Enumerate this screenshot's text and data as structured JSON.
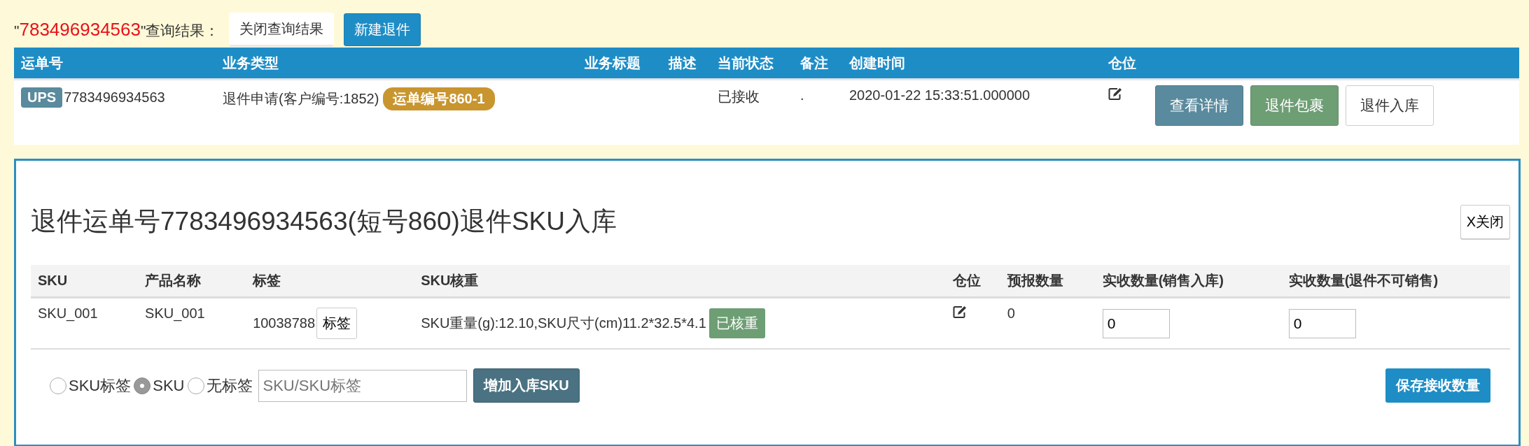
{
  "query": {
    "open_quote": "\"",
    "number": "783496934563",
    "suffix": "\"查询结果：",
    "buttons": [
      {
        "label": "关闭查询结果",
        "kind": "plain"
      },
      {
        "label": "新建退件",
        "kind": "primary"
      }
    ]
  },
  "results": {
    "columns": [
      "运单号",
      "业务类型",
      "业务标题",
      "描述",
      "当前状态",
      "备注",
      "创建时间",
      "仓位"
    ],
    "rows": [
      {
        "carrier": "UPS",
        "tracking": "7783496934563",
        "type": "退件申请(客户编号:1852)",
        "tag": "运单编号860-1",
        "status": "已接收",
        "note": ".",
        "created": "2020-01-22 15:33:51.000000",
        "actions": [
          {
            "label": "查看详情",
            "kind": "info"
          },
          {
            "label": "退件包裹",
            "kind": "success"
          },
          {
            "label": "退件入库",
            "kind": "plain"
          }
        ]
      }
    ]
  },
  "panel": {
    "title": "退件运单号7783496934563(短号860)退件SKU入库",
    "close_button": "X关闭",
    "columns": [
      "SKU",
      "产品名称",
      "标签",
      "SKU核重",
      "仓位",
      "预报数量",
      "实收数量(销售入库)",
      "实收数量(退件不可销售)"
    ],
    "rows": [
      {
        "sku": "SKU_001",
        "name": "SKU_001",
        "label_code": "10038788",
        "label_button": "标签",
        "check": "SKU重量(g):12.10,SKU尺寸(cm)11.2*32.5*4.1",
        "check_badge": "已核重",
        "forecast": "0",
        "qty_sale": "0",
        "qty_return": "0"
      }
    ],
    "mode_options": [
      {
        "label": "SKU标签",
        "selected": false
      },
      {
        "label": "SKU",
        "selected": true
      },
      {
        "label": "无标签",
        "selected": false
      }
    ],
    "sku_input": {
      "placeholder": "SKU/SKU标签"
    },
    "add_button": "增加入库SKU",
    "save_button": "保存接收数量"
  }
}
